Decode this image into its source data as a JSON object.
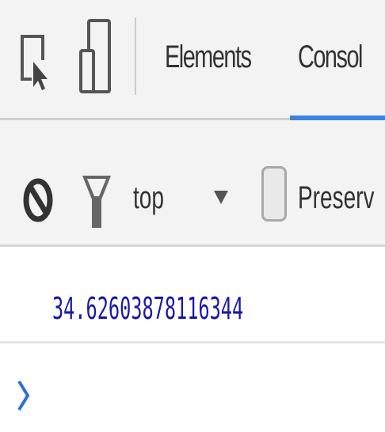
{
  "tabs": [
    {
      "label": "Elements",
      "active": false
    },
    {
      "label": "Consol",
      "active": true
    }
  ],
  "toolbar": {
    "inspect_icon": "inspect-element-icon",
    "device_icon": "device-toolbar-icon",
    "clear_icon": "clear-console-icon",
    "filter_icon": "filter-icon",
    "context": "top",
    "context_dropdown_icon": "dropdown-triangle-icon",
    "preserve_label": "Preserv",
    "preserve_checked": false
  },
  "console": {
    "output": "34.62603878116344",
    "prompt_icon": "prompt-chevron-icon"
  },
  "colors": {
    "accent": "#3b82e0",
    "output_text": "#1a1aa6",
    "toolbar_bg": "#f3f3f3"
  }
}
